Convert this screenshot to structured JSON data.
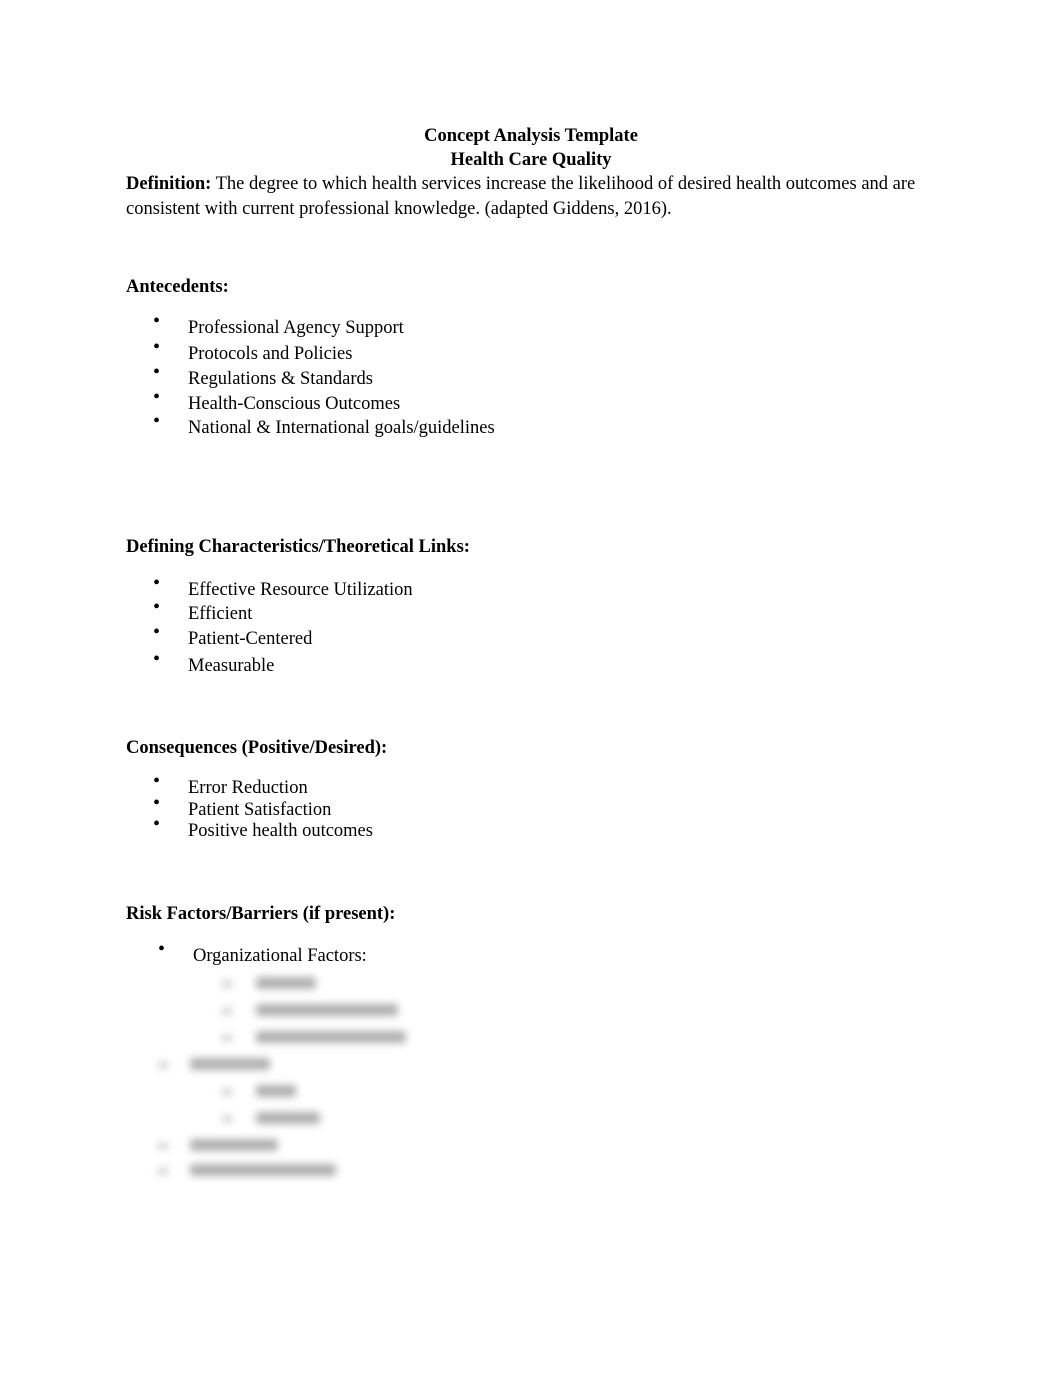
{
  "document": {
    "title": "Concept Analysis Template",
    "subtitle": "Health Care Quality",
    "definition": {
      "label": "Definition:",
      "text": " The degree to which health services increase the likelihood of desired health outcomes and are consistent with current professional knowledge. (adapted Giddens, 2016)."
    },
    "sections": [
      {
        "heading": "Antecedents:",
        "items": [
          "Professional Agency Support",
          "Protocols and Policies",
          "Regulations & Standards",
          "Health-Conscious Outcomes",
          "National & International goals/guidelines"
        ]
      },
      {
        "heading": "Defining Characteristics/Theoretical Links:",
        "items": [
          "Effective Resource Utilization",
          "Efficient",
          "Patient-Centered",
          "Measurable"
        ]
      },
      {
        "heading": "Consequences (Positive/Desired):",
        "items": [
          "Error Reduction",
          "Patient Satisfaction",
          "Positive health outcomes"
        ]
      },
      {
        "heading": "Risk Factors/Barriers (if present):",
        "items": [
          "Organizational Factors:"
        ]
      }
    ],
    "bullet_glyph": "•"
  }
}
